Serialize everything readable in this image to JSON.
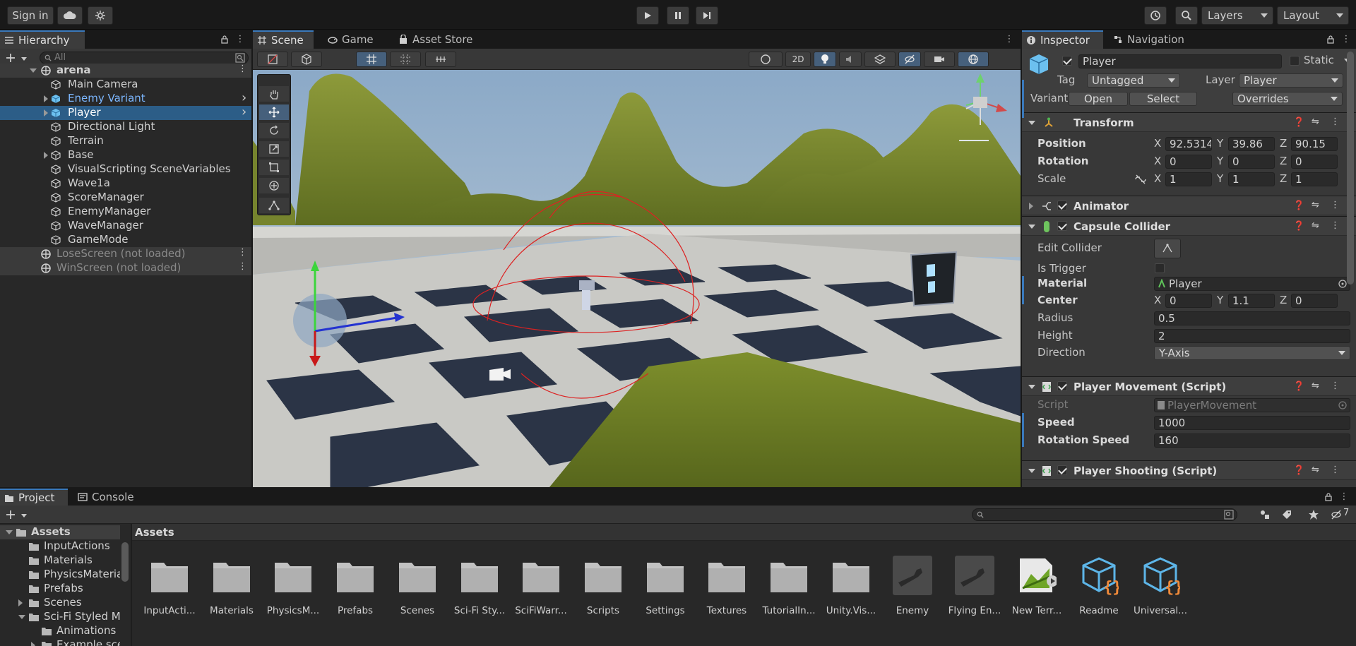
{
  "toolbar": {
    "sign_in": "Sign in",
    "layers": "Layers",
    "layout": "Layout",
    "icons": [
      "cloud-icon",
      "collab-icon",
      "play-icon",
      "pause-icon",
      "step-icon",
      "history-icon",
      "search-icon"
    ]
  },
  "hierarchy": {
    "tab": "Hierarchy",
    "search_placeholder": "All",
    "rows": [
      {
        "label": "arena",
        "kind": "scene"
      },
      {
        "label": "Main Camera",
        "kind": "object"
      },
      {
        "label": "Enemy Variant",
        "kind": "prefab"
      },
      {
        "label": "Player",
        "kind": "prefab-selected"
      },
      {
        "label": "Directional Light",
        "kind": "object"
      },
      {
        "label": "Terrain",
        "kind": "object"
      },
      {
        "label": "Base",
        "kind": "object"
      },
      {
        "label": "VisualScripting SceneVariables",
        "kind": "object"
      },
      {
        "label": "Wave1a",
        "kind": "object"
      },
      {
        "label": "ScoreManager",
        "kind": "object"
      },
      {
        "label": "EnemyManager",
        "kind": "object"
      },
      {
        "label": "WaveManager",
        "kind": "object"
      },
      {
        "label": "GameMode",
        "kind": "object"
      },
      {
        "label": "LoseScreen (not loaded)",
        "kind": "scene-unloaded"
      },
      {
        "label": "WinScreen (not loaded)",
        "kind": "scene-unloaded"
      }
    ]
  },
  "scene_view": {
    "tabs": [
      "Scene",
      "Game",
      "Asset Store"
    ],
    "toolbar": {
      "mode_2d": "2D"
    },
    "gizmo_axes": {
      "y": "y",
      "x": "x"
    }
  },
  "inspector": {
    "tabs": [
      "Inspector",
      "Navigation"
    ],
    "object_name": "Player",
    "static_label": "Static",
    "tag_label": "Tag",
    "tag_value": "Untagged",
    "layer_label": "Layer",
    "layer_value": "Player",
    "variant_label": "Variant",
    "open_button": "Open",
    "select_button": "Select",
    "overrides": "Overrides",
    "transform": {
      "title": "Transform",
      "position_label": "Position",
      "rotation_label": "Rotation",
      "scale_label": "Scale",
      "position": {
        "x": "92.5314",
        "y": "39.86",
        "z": "90.15"
      },
      "rotation": {
        "x": "0",
        "y": "0",
        "z": "0"
      },
      "scale": {
        "x": "1",
        "y": "1",
        "z": "1"
      }
    },
    "animator": {
      "title": "Animator"
    },
    "capsule": {
      "title": "Capsule Collider",
      "edit_collider": "Edit Collider",
      "is_trigger": "Is Trigger",
      "material_label": "Material",
      "material_value": "Player",
      "center_label": "Center",
      "center": {
        "x": "0",
        "y": "1.1",
        "z": "0"
      },
      "radius_label": "Radius",
      "radius": "0.5",
      "height_label": "Height",
      "height": "2",
      "direction_label": "Direction",
      "direction": "Y-Axis"
    },
    "movement": {
      "title": "Player Movement (Script)",
      "script_label": "Script",
      "script_value": "PlayerMovement",
      "speed_label": "Speed",
      "speed": "1000",
      "rotation_speed_label": "Rotation Speed",
      "rotation_speed": "160"
    },
    "shooting": {
      "title": "Player Shooting (Script)"
    },
    "axis_letters": {
      "x": "X",
      "y": "Y",
      "z": "Z"
    }
  },
  "project": {
    "tabs": [
      "Project",
      "Console"
    ],
    "hidden_count": "7",
    "breadcrumb": "Assets",
    "tree": [
      {
        "label": "Assets",
        "depth": 0,
        "fold": "down",
        "bold": true
      },
      {
        "label": "InputActions",
        "depth": 1,
        "fold": ""
      },
      {
        "label": "Materials",
        "depth": 1,
        "fold": ""
      },
      {
        "label": "PhysicsMateria",
        "depth": 1,
        "fold": ""
      },
      {
        "label": "Prefabs",
        "depth": 1,
        "fold": ""
      },
      {
        "label": "Scenes",
        "depth": 1,
        "fold": "right"
      },
      {
        "label": "Sci-Fi Styled M",
        "depth": 1,
        "fold": "down"
      },
      {
        "label": "Animations",
        "depth": 2,
        "fold": ""
      },
      {
        "label": "Example sce",
        "depth": 2,
        "fold": "right"
      }
    ],
    "assets": [
      {
        "label": "InputActi...",
        "type": "folder"
      },
      {
        "label": "Materials",
        "type": "folder"
      },
      {
        "label": "PhysicsM...",
        "type": "folder"
      },
      {
        "label": "Prefabs",
        "type": "folder"
      },
      {
        "label": "Scenes",
        "type": "folder"
      },
      {
        "label": "Sci-Fi Sty...",
        "type": "folder"
      },
      {
        "label": "SciFiWarr...",
        "type": "folder"
      },
      {
        "label": "Scripts",
        "type": "folder"
      },
      {
        "label": "Settings",
        "type": "folder"
      },
      {
        "label": "Textures",
        "type": "folder"
      },
      {
        "label": "TutorialIn...",
        "type": "folder"
      },
      {
        "label": "Unity.Vis...",
        "type": "folder"
      },
      {
        "label": "Enemy",
        "type": "prefab-model"
      },
      {
        "label": "Flying En...",
        "type": "prefab-model"
      },
      {
        "label": "New Terr...",
        "type": "terrain"
      },
      {
        "label": "Readme",
        "type": "script"
      },
      {
        "label": "Universal...",
        "type": "script"
      }
    ]
  }
}
